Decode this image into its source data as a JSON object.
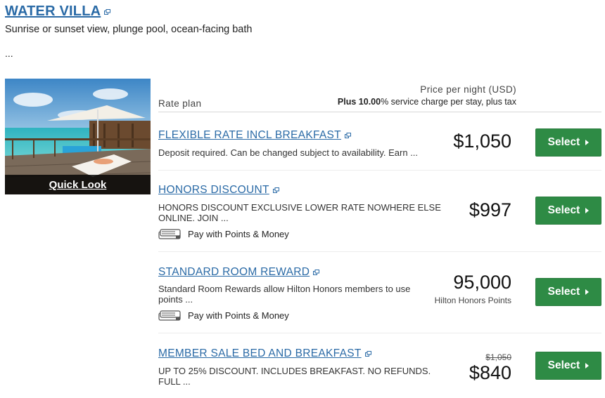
{
  "room": {
    "title": "WATER VILLA",
    "description": "Sunrise or sunset view, plunge pool, ocean-facing bath",
    "ellipsis": "...",
    "quick_look": "Quick Look"
  },
  "rates_header": {
    "rate_plan": "Rate plan",
    "price_per_night": "Price per night (USD)",
    "service_bold": "Plus 10.00",
    "service_rest": "% service charge per stay, plus tax"
  },
  "rates": [
    {
      "name": "FLEXIBLE RATE INCL BREAKFAST",
      "description_lines": [
        "Deposit required. Can be changed subject to availability. Earn ..."
      ],
      "price": "$1,050",
      "select": "Select"
    },
    {
      "name": "HONORS DISCOUNT",
      "description_lines": [
        "HONORS DISCOUNT EXCLUSIVE LOWER RATE NOWHERE ELSE",
        "ONLINE. JOIN ..."
      ],
      "pay_with": "Pay with Points & Money",
      "price": "$997",
      "select": "Select"
    },
    {
      "name": "STANDARD ROOM REWARD",
      "description_lines": [
        "Standard Room Rewards allow Hilton Honors members to use",
        "points ..."
      ],
      "pay_with": "Pay with Points & Money",
      "price": "95,000",
      "price_unit": "Hilton Honors Points",
      "select": "Select"
    },
    {
      "name": "MEMBER SALE BED AND BREAKFAST",
      "description_lines": [
        "UP TO 25% DISCOUNT. INCLUDES BREAKFAST. NO REFUNDS.",
        "FULL ..."
      ],
      "original_price": "$1,050",
      "price": "$840",
      "select": "Select"
    }
  ],
  "colors": {
    "link": "#2a6aa6",
    "select_button": "#2e8b45"
  },
  "icons": [
    "external-link-icon",
    "points-money-icon",
    "caret-right-icon"
  ]
}
